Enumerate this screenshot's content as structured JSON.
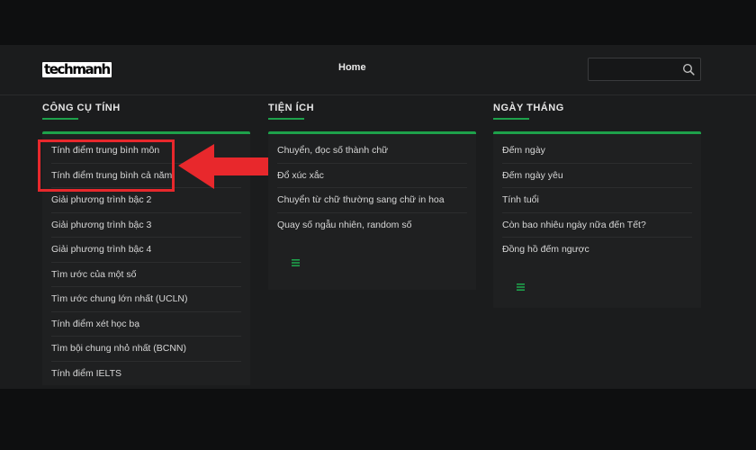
{
  "header": {
    "logo": "techmanh",
    "nav_home": "Home",
    "search_placeholder": ""
  },
  "columns": [
    {
      "title": "CÔNG CỤ TÍNH",
      "items": [
        "Tính điểm trung bình môn",
        "Tính điểm trung bình cả năm",
        "Giải phương trình bậc 2",
        "Giải phương trình bậc 3",
        "Giải phương trình bậc 4",
        "Tìm ước của một số",
        "Tìm ước chung lớn nhất (UCLN)",
        "Tính điểm xét học bạ",
        "Tìm bội chung nhỏ nhất (BCNN)",
        "Tính điểm IELTS"
      ]
    },
    {
      "title": "TIỆN ÍCH",
      "items": [
        "Chuyển, đọc số thành chữ",
        "Đổ xúc xắc",
        "Chuyển từ chữ thường sang chữ in hoa",
        "Quay số ngẫu nhiên, random số"
      ]
    },
    {
      "title": "NGÀY THÁNG",
      "items": [
        "Đếm ngày",
        "Đếm ngày yêu",
        "Tính tuổi",
        "Còn bao nhiêu ngày nữa đến Tết?",
        "Đồng hồ đếm ngược"
      ]
    }
  ],
  "icons": {
    "search": "search-icon",
    "menu": "hamburger-menu-icon",
    "annotation_arrow": "red-arrow-icon"
  },
  "colors": {
    "accent": "#1ea14b",
    "highlight": "#e8282c",
    "background": "#1b1c1d"
  }
}
